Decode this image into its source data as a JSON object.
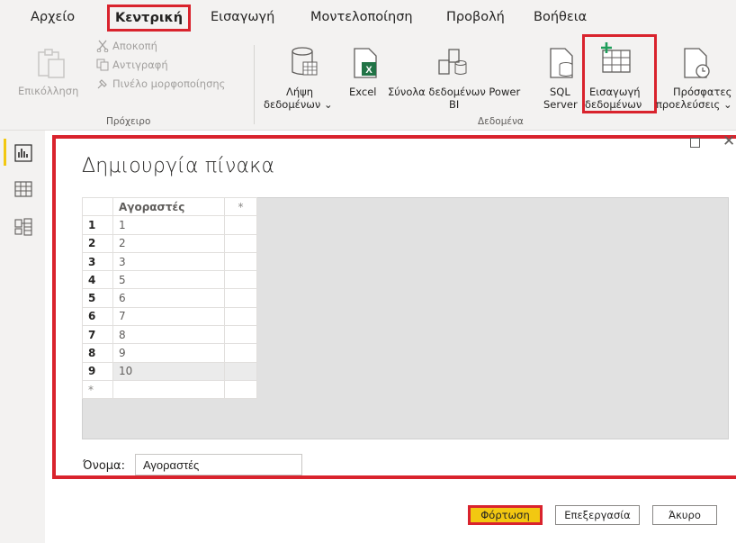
{
  "ribbon": {
    "tabs": [
      "Αρχείο",
      "Κεντρική",
      "Εισαγωγή",
      "Μοντελοποίηση",
      "Προβολή",
      "Βοήθεια"
    ],
    "active_tab": "Κεντρική",
    "clipboard": {
      "paste": "Επικόλληση",
      "cut": "Αποκοπή",
      "copy": "Αντιγραφή",
      "format_painter": "Πινέλο μορφοποίησης",
      "group_label": "Πρόχειρο"
    },
    "data": {
      "get_data_line1": "Λήψη",
      "get_data_line2": "δεδομένων ⌄",
      "excel": "Excel",
      "datasets_line1": "Σύνολα δεδομένων Power",
      "datasets_line2": "BI",
      "sql_line1": "SQL",
      "sql_line2": "Server",
      "enter_data_line1": "Εισαγωγή",
      "enter_data_line2": "δεδομένων",
      "recent_line1": "Πρόσφατες",
      "recent_line2": "προελεύσεις ⌄",
      "group_label": "Δεδομένα"
    }
  },
  "rail": {
    "icons": [
      "report-view-icon",
      "table-view-icon",
      "model-view-icon"
    ]
  },
  "dialog": {
    "title": "Δημιουργία πίνακα",
    "column_header": "Αγοραστές",
    "add_column_symbol": "*",
    "rows": [
      {
        "n": "1",
        "v": "1"
      },
      {
        "n": "2",
        "v": "2"
      },
      {
        "n": "3",
        "v": "3"
      },
      {
        "n": "4",
        "v": "5"
      },
      {
        "n": "5",
        "v": "6"
      },
      {
        "n": "6",
        "v": "7"
      },
      {
        "n": "7",
        "v": "8"
      },
      {
        "n": "8",
        "v": "9"
      },
      {
        "n": "9",
        "v": "10"
      }
    ],
    "new_row_symbol": "*",
    "name_label": "Όνομα:",
    "name_value": "Αγοραστές",
    "buttons": {
      "load": "Φόρτωση",
      "edit": "Επεξεργασία",
      "cancel": "Άκυρο"
    }
  },
  "colors": {
    "highlight": "#d9232d",
    "accent_yellow": "#f2c811",
    "ribbon_bg": "#f3f2f1",
    "excel_green": "#217346",
    "enter_data_green": "#1e9e5a"
  }
}
